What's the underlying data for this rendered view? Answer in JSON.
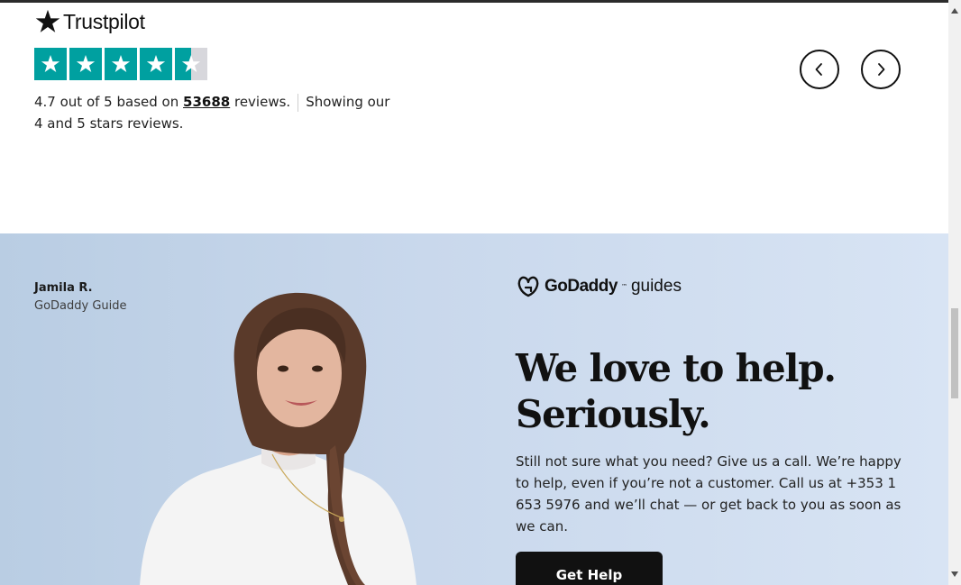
{
  "trustpilot": {
    "brand": "Trustpilot",
    "rating_value": 4.7,
    "rating_max": 5,
    "rating_prefix": "4.7 out of 5 based on",
    "review_count": "53688",
    "rating_suffix": "reviews.",
    "filter_note": "Showing our 4 and 5 stars reviews.",
    "star_color": "#00a0a0"
  },
  "carousel": {
    "prev_icon": "chevron-left-icon",
    "next_icon": "chevron-right-icon"
  },
  "help": {
    "guide_name": "Jamila R.",
    "guide_role": "GoDaddy Guide",
    "logo_brand": "GoDaddy",
    "logo_sub": "guides",
    "headline_line1": "We love to help.",
    "headline_line2": "Seriously.",
    "body": "Still not sure what you need? Give us a call. We’re happy to help, even if you’re not a customer. Call us at +353 1 653 5976 and we’ll chat — or get back to you as soon as we can.",
    "cta_label": "Get Help"
  },
  "colors": {
    "background": "#ffffff",
    "help_bg": "#c9d8ec",
    "cta_bg": "#111111",
    "accent": "#00a0a0"
  }
}
